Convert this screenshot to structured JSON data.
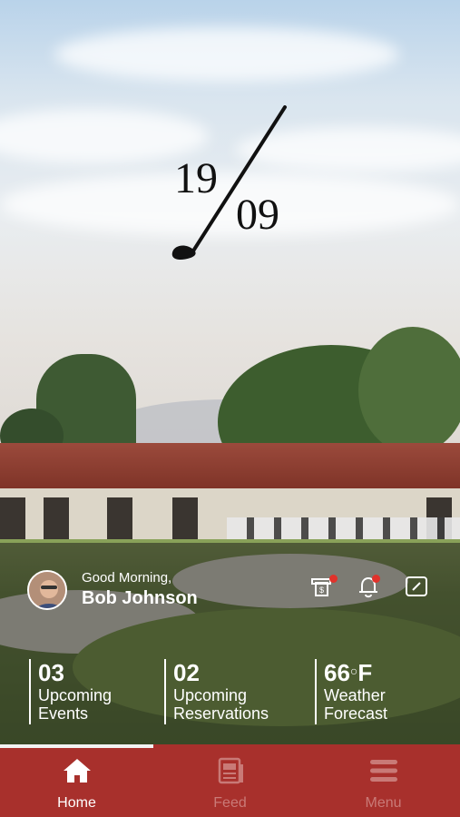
{
  "logo": {
    "top": "19",
    "bottom": "09"
  },
  "greeting": {
    "salutation": "Good Morning,",
    "name": "Bob Johnson"
  },
  "actions": [
    {
      "icon": "statement-icon",
      "has_badge": true
    },
    {
      "icon": "bell-icon",
      "has_badge": true
    },
    {
      "icon": "edit-icon",
      "has_badge": false
    }
  ],
  "stats": {
    "events": {
      "value": "03",
      "label_line1": "Upcoming",
      "label_line2": "Events"
    },
    "reservations": {
      "value": "02",
      "label_line1": "Upcoming",
      "label_line2": "Reservations"
    },
    "weather": {
      "value": "66",
      "unit": "F",
      "degree": "○",
      "label_line1": "Weather",
      "label_line2": "Forecast"
    }
  },
  "nav": {
    "items": [
      {
        "label": "Home",
        "icon": "home-icon",
        "active": true
      },
      {
        "label": "Feed",
        "icon": "feed-icon",
        "active": false
      },
      {
        "label": "Menu",
        "icon": "menu-icon",
        "active": false
      }
    ]
  },
  "colors": {
    "nav_background": "#a8302c",
    "badge": "#e0322b",
    "inactive_nav": "#c97a77"
  }
}
